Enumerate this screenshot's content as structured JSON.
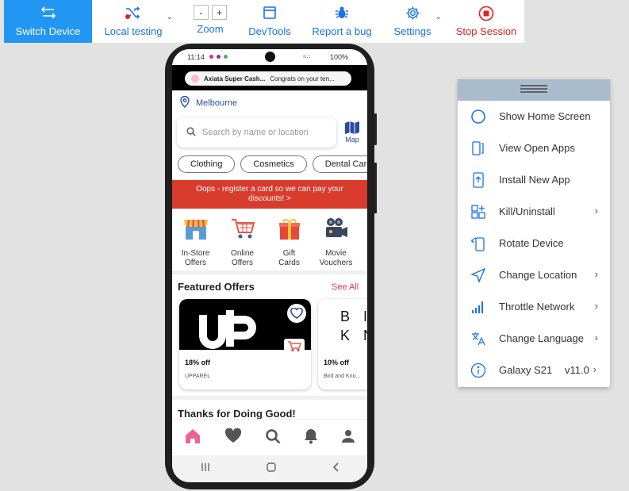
{
  "toolbar": {
    "switch_device": "Switch Device",
    "local_testing": "Local testing",
    "zoom": "Zoom",
    "zoom_minus": "-",
    "zoom_plus": "+",
    "devtools": "DevTools",
    "report_bug": "Report a bug",
    "settings": "Settings",
    "stop_session": "Stop Session",
    "accent": "#2196f3",
    "stop_color": "#e02020"
  },
  "phone": {
    "status_time": "11:14",
    "status_battery": "100%",
    "notification_app": "Axiata Super Cash...",
    "notification_text": "Congrats on your ten...",
    "location": "Melbourne",
    "search_placeholder": "Search by name or location",
    "map_label": "Map",
    "chips": [
      "Clothing",
      "Cosmetics",
      "Dental Care"
    ],
    "banner_line1": "Oops - register a card so we can pay your",
    "banner_line2": "discounts! >",
    "banner_color": "#d93b2c",
    "categories": [
      {
        "line1": "In-Store",
        "line2": "Offers"
      },
      {
        "line1": "Online",
        "line2": "Offers"
      },
      {
        "line1": "Gift",
        "line2": "Cards"
      },
      {
        "line1": "Movie",
        "line2": "Vouchers"
      }
    ],
    "featured_title": "Featured Offers",
    "see_all": "See All",
    "offers": [
      {
        "percent": "18% off",
        "brand": "UPPAREL"
      },
      {
        "percent": "10% off",
        "brand": "Bird and Kno..."
      }
    ],
    "offer2_logo_line1": "B I",
    "offer2_logo_line2": "K N",
    "thanks_title": "Thanks for Doing Good!",
    "bottom_nav_icons": [
      "home-icon",
      "heart-icon",
      "search-icon",
      "bell-icon",
      "profile-icon"
    ],
    "accent_pink": "#e0306b"
  },
  "menu": {
    "items": [
      {
        "label": "Show Home Screen",
        "icon": "home-circle-icon"
      },
      {
        "label": "View Open Apps",
        "icon": "open-apps-icon"
      },
      {
        "label": "Install New App",
        "icon": "install-icon"
      },
      {
        "label": "Kill/Uninstall",
        "icon": "kill-icon"
      },
      {
        "label": "Rotate Device",
        "icon": "rotate-icon"
      },
      {
        "label": "Change Location",
        "icon": "location-arrow-icon"
      },
      {
        "label": "Throttle Network",
        "icon": "signal-icon"
      },
      {
        "label": "Change Language",
        "icon": "language-icon"
      },
      {
        "label": "Galaxy S21",
        "icon": "info-icon",
        "value": "v11.0"
      }
    ],
    "handle_color": "#a9bccd"
  }
}
